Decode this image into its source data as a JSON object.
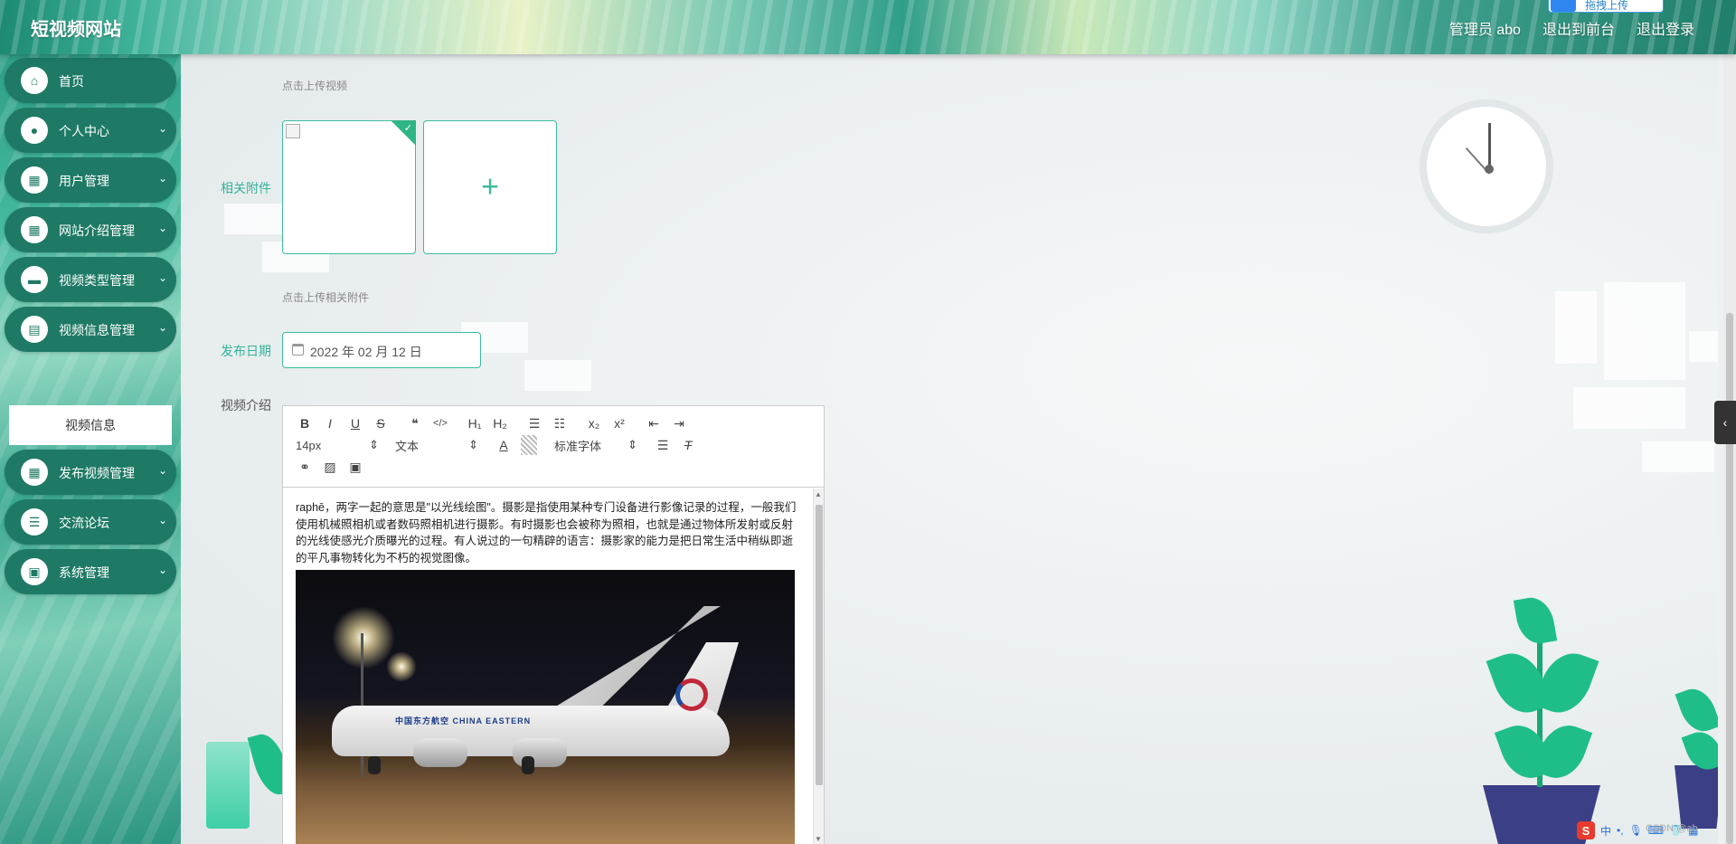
{
  "header": {
    "site_title": "短视频网站",
    "admin_label": "管理员 abo",
    "to_frontend": "退出到前台",
    "logout": "退出登录",
    "drag_upload": "拖拽上传"
  },
  "sidebar": {
    "items": [
      {
        "label": "首页",
        "icon": "home-icon",
        "has_arrow": false
      },
      {
        "label": "个人中心",
        "icon": "user-icon",
        "has_arrow": true
      },
      {
        "label": "用户管理",
        "icon": "grid-icon",
        "has_arrow": true
      },
      {
        "label": "网站介绍管理",
        "icon": "grid-icon",
        "has_arrow": true
      },
      {
        "label": "视频类型管理",
        "icon": "briefcase-icon",
        "has_arrow": true
      },
      {
        "label": "视频信息管理",
        "icon": "clipboard-icon",
        "has_arrow": true
      },
      {
        "label": "发布视频管理",
        "icon": "grid-icon",
        "has_arrow": true
      },
      {
        "label": "交流论坛",
        "icon": "list-icon",
        "has_arrow": true
      },
      {
        "label": "系统管理",
        "icon": "doc-icon",
        "has_arrow": true
      }
    ],
    "submenu_active": "视频信息",
    "arrow_glyph": "⌄"
  },
  "form": {
    "upload_video_hint": "点击上传视频",
    "attachment_label": "相关附件",
    "attachment_hint": "点击上传相关附件",
    "add_plus": "+",
    "publish_date_label": "发布日期",
    "publish_date_value": "2022 年 02 月 12 日",
    "intro_label": "视频介绍"
  },
  "editor": {
    "toolbar_row1": [
      "B",
      "I",
      "U",
      "S",
      "❝",
      "</>",
      "H₁",
      "H₂",
      "☰",
      "☷",
      "x₂",
      "x²",
      "⇤",
      "⇥"
    ],
    "font_size": "14px",
    "block_type": "文本",
    "font_family": "标准字体",
    "content": "raphē，两字一起的意思是\"以光线绘图\"。摄影是指使用某种专门设备进行影像记录的过程，一般我们使用机械照相机或者数码照相机进行摄影。有时摄影也会被称为照相，也就是通过物体所发射或反射的光线使感光介质曝光的过程。有人说过的一句精辟的语言：摄影家的能力是把日常生活中稍纵即逝的平凡事物转化为不朽的视觉图像。",
    "photo_livery": "中国东方航空 CHINA EASTERN"
  },
  "system": {
    "ime_char": "中",
    "watermark": "CSDN @ab"
  },
  "colors": {
    "accent": "#1e7a65",
    "label_green": "#33b39a"
  }
}
